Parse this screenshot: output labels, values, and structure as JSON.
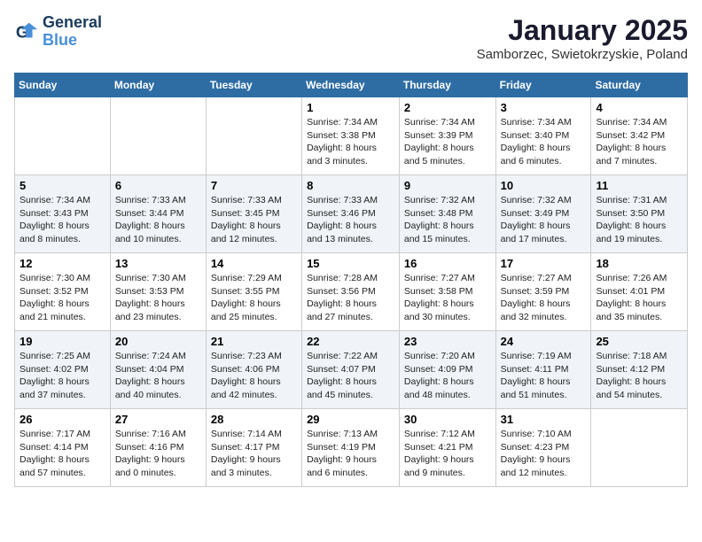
{
  "logo": {
    "line1": "General",
    "line2": "Blue"
  },
  "title": "January 2025",
  "subtitle": "Samborzec, Swietokrzyskie, Poland",
  "days_header": [
    "Sunday",
    "Monday",
    "Tuesday",
    "Wednesday",
    "Thursday",
    "Friday",
    "Saturday"
  ],
  "weeks": [
    [
      {
        "day": "",
        "info": ""
      },
      {
        "day": "",
        "info": ""
      },
      {
        "day": "",
        "info": ""
      },
      {
        "day": "1",
        "info": "Sunrise: 7:34 AM\nSunset: 3:38 PM\nDaylight: 8 hours\nand 3 minutes."
      },
      {
        "day": "2",
        "info": "Sunrise: 7:34 AM\nSunset: 3:39 PM\nDaylight: 8 hours\nand 5 minutes."
      },
      {
        "day": "3",
        "info": "Sunrise: 7:34 AM\nSunset: 3:40 PM\nDaylight: 8 hours\nand 6 minutes."
      },
      {
        "day": "4",
        "info": "Sunrise: 7:34 AM\nSunset: 3:42 PM\nDaylight: 8 hours\nand 7 minutes."
      }
    ],
    [
      {
        "day": "5",
        "info": "Sunrise: 7:34 AM\nSunset: 3:43 PM\nDaylight: 8 hours\nand 8 minutes."
      },
      {
        "day": "6",
        "info": "Sunrise: 7:33 AM\nSunset: 3:44 PM\nDaylight: 8 hours\nand 10 minutes."
      },
      {
        "day": "7",
        "info": "Sunrise: 7:33 AM\nSunset: 3:45 PM\nDaylight: 8 hours\nand 12 minutes."
      },
      {
        "day": "8",
        "info": "Sunrise: 7:33 AM\nSunset: 3:46 PM\nDaylight: 8 hours\nand 13 minutes."
      },
      {
        "day": "9",
        "info": "Sunrise: 7:32 AM\nSunset: 3:48 PM\nDaylight: 8 hours\nand 15 minutes."
      },
      {
        "day": "10",
        "info": "Sunrise: 7:32 AM\nSunset: 3:49 PM\nDaylight: 8 hours\nand 17 minutes."
      },
      {
        "day": "11",
        "info": "Sunrise: 7:31 AM\nSunset: 3:50 PM\nDaylight: 8 hours\nand 19 minutes."
      }
    ],
    [
      {
        "day": "12",
        "info": "Sunrise: 7:30 AM\nSunset: 3:52 PM\nDaylight: 8 hours\nand 21 minutes."
      },
      {
        "day": "13",
        "info": "Sunrise: 7:30 AM\nSunset: 3:53 PM\nDaylight: 8 hours\nand 23 minutes."
      },
      {
        "day": "14",
        "info": "Sunrise: 7:29 AM\nSunset: 3:55 PM\nDaylight: 8 hours\nand 25 minutes."
      },
      {
        "day": "15",
        "info": "Sunrise: 7:28 AM\nSunset: 3:56 PM\nDaylight: 8 hours\nand 27 minutes."
      },
      {
        "day": "16",
        "info": "Sunrise: 7:27 AM\nSunset: 3:58 PM\nDaylight: 8 hours\nand 30 minutes."
      },
      {
        "day": "17",
        "info": "Sunrise: 7:27 AM\nSunset: 3:59 PM\nDaylight: 8 hours\nand 32 minutes."
      },
      {
        "day": "18",
        "info": "Sunrise: 7:26 AM\nSunset: 4:01 PM\nDaylight: 8 hours\nand 35 minutes."
      }
    ],
    [
      {
        "day": "19",
        "info": "Sunrise: 7:25 AM\nSunset: 4:02 PM\nDaylight: 8 hours\nand 37 minutes."
      },
      {
        "day": "20",
        "info": "Sunrise: 7:24 AM\nSunset: 4:04 PM\nDaylight: 8 hours\nand 40 minutes."
      },
      {
        "day": "21",
        "info": "Sunrise: 7:23 AM\nSunset: 4:06 PM\nDaylight: 8 hours\nand 42 minutes."
      },
      {
        "day": "22",
        "info": "Sunrise: 7:22 AM\nSunset: 4:07 PM\nDaylight: 8 hours\nand 45 minutes."
      },
      {
        "day": "23",
        "info": "Sunrise: 7:20 AM\nSunset: 4:09 PM\nDaylight: 8 hours\nand 48 minutes."
      },
      {
        "day": "24",
        "info": "Sunrise: 7:19 AM\nSunset: 4:11 PM\nDaylight: 8 hours\nand 51 minutes."
      },
      {
        "day": "25",
        "info": "Sunrise: 7:18 AM\nSunset: 4:12 PM\nDaylight: 8 hours\nand 54 minutes."
      }
    ],
    [
      {
        "day": "26",
        "info": "Sunrise: 7:17 AM\nSunset: 4:14 PM\nDaylight: 8 hours\nand 57 minutes."
      },
      {
        "day": "27",
        "info": "Sunrise: 7:16 AM\nSunset: 4:16 PM\nDaylight: 9 hours\nand 0 minutes."
      },
      {
        "day": "28",
        "info": "Sunrise: 7:14 AM\nSunset: 4:17 PM\nDaylight: 9 hours\nand 3 minutes."
      },
      {
        "day": "29",
        "info": "Sunrise: 7:13 AM\nSunset: 4:19 PM\nDaylight: 9 hours\nand 6 minutes."
      },
      {
        "day": "30",
        "info": "Sunrise: 7:12 AM\nSunset: 4:21 PM\nDaylight: 9 hours\nand 9 minutes."
      },
      {
        "day": "31",
        "info": "Sunrise: 7:10 AM\nSunset: 4:23 PM\nDaylight: 9 hours\nand 12 minutes."
      },
      {
        "day": "",
        "info": ""
      }
    ]
  ]
}
